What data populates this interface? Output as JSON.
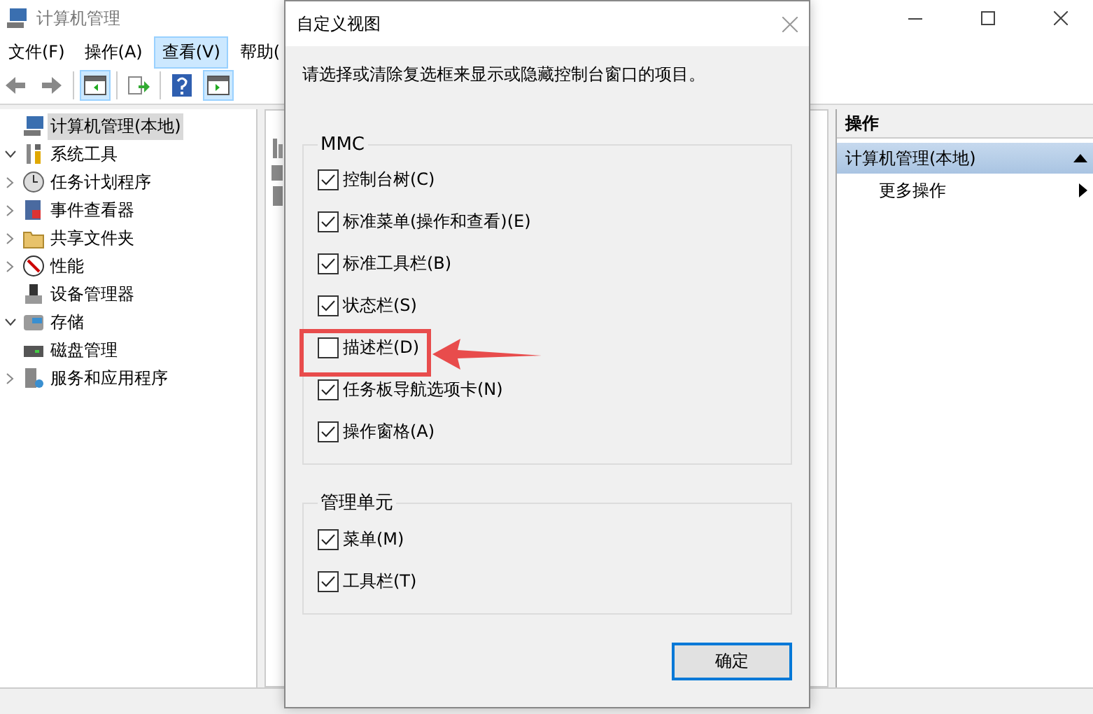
{
  "window": {
    "title": "计算机管理"
  },
  "menu": [
    {
      "label": "文件(F)",
      "selected": false
    },
    {
      "label": "操作(A)",
      "selected": false
    },
    {
      "label": "查看(V)",
      "selected": true
    },
    {
      "label": "帮助(",
      "selected": false
    }
  ],
  "toolbar": [
    {
      "kind": "back",
      "pressed": false
    },
    {
      "kind": "forward",
      "pressed": false
    },
    {
      "kind": "tree-toggle",
      "pressed": true
    },
    {
      "kind": "export",
      "pressed": false
    },
    {
      "kind": "help",
      "pressed": false
    },
    {
      "kind": "pane-toggle",
      "pressed": true
    }
  ],
  "tree": [
    {
      "label": "计算机管理(本地)",
      "kind": "computer",
      "selected": true,
      "children": [
        {
          "label": "系统工具",
          "kind": "tools",
          "selected": false,
          "expanded": true,
          "children": [
            {
              "label": "任务计划程序",
              "kind": "clock",
              "selected": false,
              "expanded": false
            },
            {
              "label": "事件查看器",
              "kind": "log",
              "selected": false,
              "expanded": false
            },
            {
              "label": "共享文件夹",
              "kind": "folder",
              "selected": false,
              "expanded": false
            },
            {
              "label": "性能",
              "kind": "gauge",
              "selected": false,
              "expanded": false
            },
            {
              "label": "设备管理器",
              "kind": "device",
              "selected": false
            }
          ]
        },
        {
          "label": "存储",
          "kind": "storage",
          "selected": false,
          "expanded": true,
          "children": [
            {
              "label": "磁盘管理",
              "kind": "disk",
              "selected": false
            }
          ]
        },
        {
          "label": "服务和应用程序",
          "kind": "services",
          "selected": false,
          "expanded": false
        }
      ]
    }
  ],
  "actions": {
    "header": "操作",
    "section": "计算机管理(本地)",
    "items": [
      "更多操作"
    ]
  },
  "dialog": {
    "title": "自定义视图",
    "description": "请选择或清除复选框来显示或隐藏控制台窗口的项目。",
    "groups": [
      {
        "title": "MMC",
        "options": [
          {
            "label": "控制台树(C)",
            "checked": true
          },
          {
            "label": "标准菜单(操作和查看)(E)",
            "checked": true
          },
          {
            "label": "标准工具栏(B)",
            "checked": true
          },
          {
            "label": "状态栏(S)",
            "checked": true
          },
          {
            "label": "描述栏(D)",
            "checked": false
          },
          {
            "label": "任务板导航选项卡(N)",
            "checked": true
          },
          {
            "label": "操作窗格(A)",
            "checked": true
          }
        ]
      },
      {
        "title": "管理单元",
        "options": [
          {
            "label": "菜单(M)",
            "checked": true
          },
          {
            "label": "工具栏(T)",
            "checked": true
          }
        ]
      }
    ],
    "button": "确定"
  }
}
